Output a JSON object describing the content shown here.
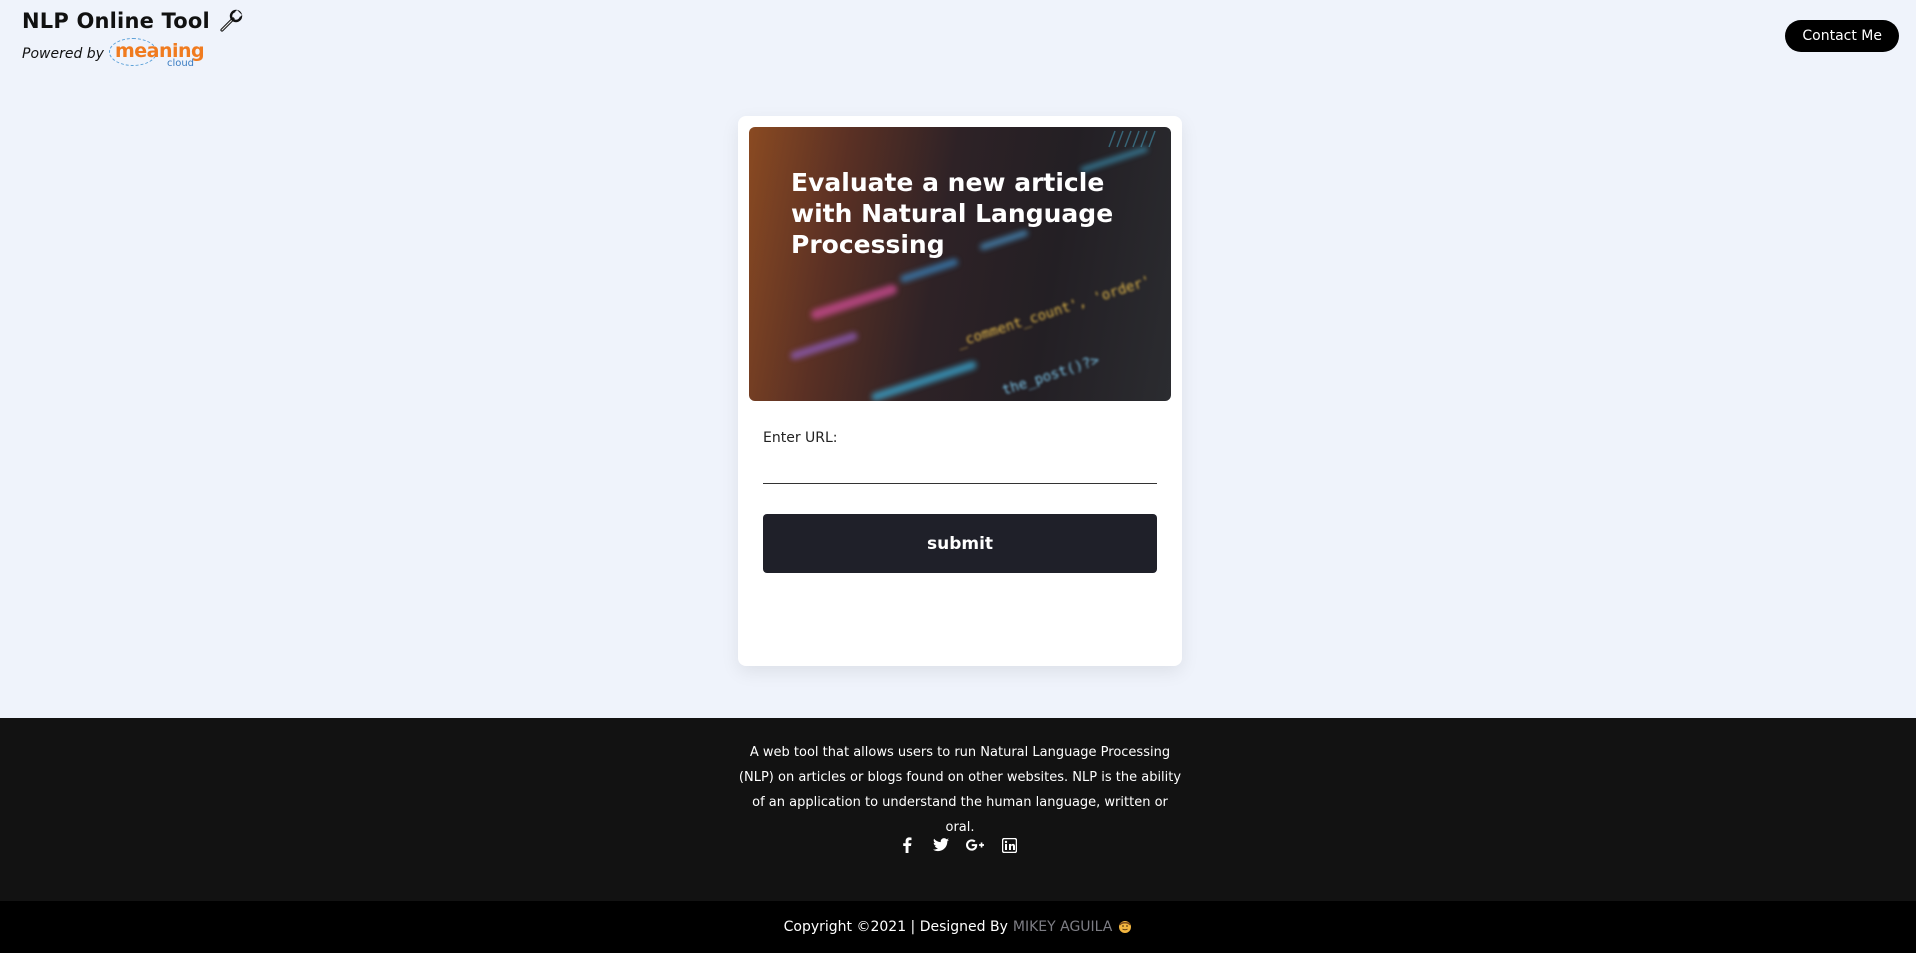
{
  "header": {
    "title": "NLP Online Tool",
    "powered_by": "Powered by",
    "logo_word": "meaning",
    "logo_sub": "cloud",
    "contact_label": "Contact Me"
  },
  "card": {
    "hero_title": "Evaluate a new article with Natural Language Processing",
    "hero_code_1": "_comment_count', 'order'",
    "hero_code_2": "the_post()?>",
    "url_label": "Enter URL:",
    "url_value": "",
    "submit_label": "submit"
  },
  "footer": {
    "description": "A web tool that allows users to run Natural Language Processing (NLP) on articles or blogs found on other websites. NLP is the ability of an application to understand the human language, written or oral.",
    "socials": [
      "facebook-icon",
      "twitter-icon",
      "google-plus-icon",
      "linkedin-icon"
    ]
  },
  "copyright": {
    "text": "Copyright ©2021 | Designed By",
    "designer": "MIKEY AGUILA"
  },
  "colors": {
    "page_bg": "#eff3fb",
    "footer_bg": "#121212",
    "bottom_bar_bg": "#000000",
    "submit_bg": "#1f2029",
    "logo_orange": "#f07b1f",
    "logo_blue": "#3a7cc2"
  }
}
